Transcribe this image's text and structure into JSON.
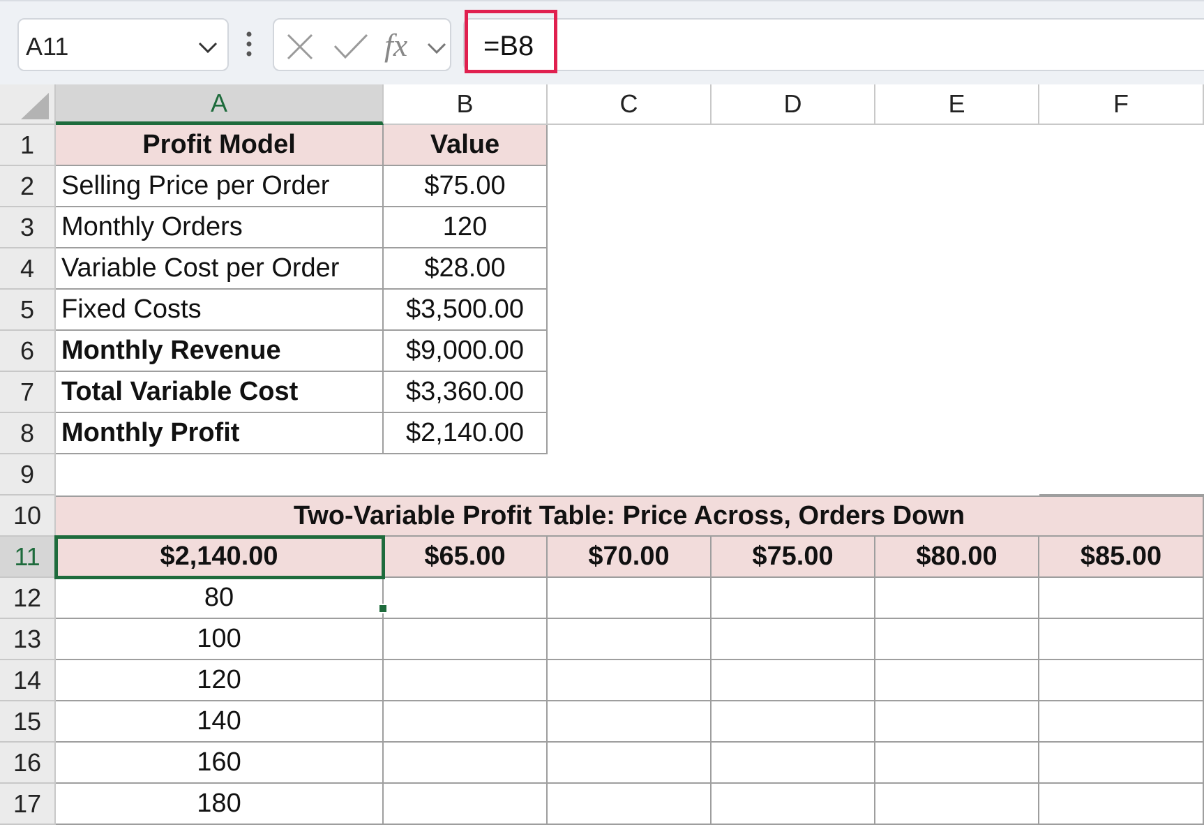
{
  "formula_bar": {
    "name_box": "A11",
    "fx_label": "fx",
    "formula": "=B8"
  },
  "columns": [
    "A",
    "B",
    "C",
    "D",
    "E",
    "F"
  ],
  "rows": [
    "1",
    "2",
    "3",
    "4",
    "5",
    "6",
    "7",
    "8",
    "9",
    "10",
    "11",
    "12",
    "13",
    "14",
    "15",
    "16",
    "17"
  ],
  "profit_model": {
    "header_label": "Profit Model",
    "header_value": "Value",
    "items": [
      {
        "label": "Selling Price per Order",
        "value": "$75.00"
      },
      {
        "label": "Monthly Orders",
        "value": "120"
      },
      {
        "label": "Variable Cost per Order",
        "value": "$28.00"
      },
      {
        "label": "Fixed Costs",
        "value": "$3,500.00"
      },
      {
        "label": "Monthly Revenue",
        "value": "$9,000.00"
      },
      {
        "label": "Total Variable Cost",
        "value": "$3,360.00"
      },
      {
        "label": "Monthly Profit",
        "value": "$2,140.00"
      }
    ]
  },
  "data_table": {
    "title": "Two-Variable Profit Table: Price Across, Orders Down",
    "corner_value": "$2,140.00",
    "prices": [
      "$65.00",
      "$70.00",
      "$75.00",
      "$80.00",
      "$85.00"
    ],
    "orders": [
      "80",
      "100",
      "120",
      "140",
      "160",
      "180"
    ]
  },
  "colors": {
    "header_fill": "#f2dcdb",
    "selection": "#1e6b3c",
    "formula_highlight": "#e0204f"
  }
}
